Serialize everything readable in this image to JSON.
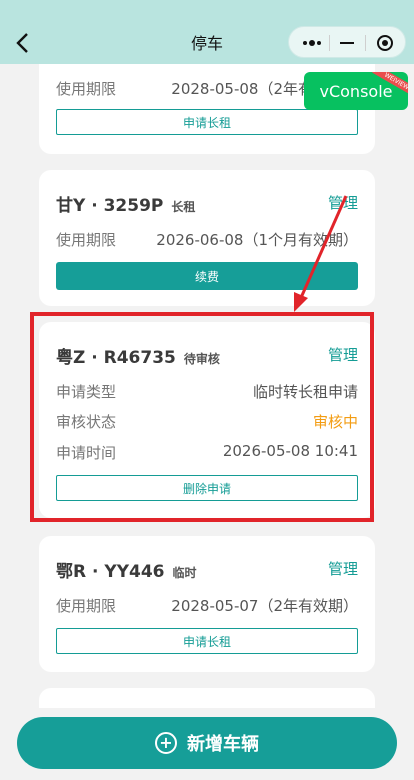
{
  "nav": {
    "back_icon": "chevron-left-icon",
    "title": "停车",
    "capsule": {
      "more_icon": "more-dots-icon",
      "minimize_icon": "minus-icon",
      "close_icon": "record-circle-icon"
    }
  },
  "vconsole": {
    "label": "vConsole",
    "badge": "WEIVIEW"
  },
  "cards": [
    {
      "rows": [
        {
          "label": "使用期限",
          "value": "2028-05-08（2年有效期）"
        }
      ],
      "button": "申请长租"
    },
    {
      "plate": "甘Y · 3259P",
      "tag": "长租",
      "manage": "管理",
      "rows": [
        {
          "label": "使用期限",
          "value": "2026-06-08（1个月有效期）"
        }
      ],
      "button": "续费"
    },
    {
      "plate": "粤Z · R46735",
      "tag": "待审核",
      "manage": "管理",
      "rows": [
        {
          "label": "申请类型",
          "value": "临时转长租申请"
        },
        {
          "label": "审核状态",
          "value": "审核中"
        },
        {
          "label": "申请时间",
          "value": "2026-05-08 10:41"
        }
      ],
      "button": "删除申请"
    },
    {
      "plate": "鄂R · YY446",
      "tag": "临时",
      "manage": "管理",
      "rows": [
        {
          "label": "使用期限",
          "value": "2028-05-07（2年有效期）"
        }
      ],
      "button": "申请长租"
    }
  ],
  "add_button": {
    "label": "新增车辆",
    "icon": "plus-circle-icon"
  },
  "colors": {
    "accent": "#169e98",
    "header": "#b9e4df",
    "pending": "#f39c12",
    "annotation": "#e1242a"
  }
}
